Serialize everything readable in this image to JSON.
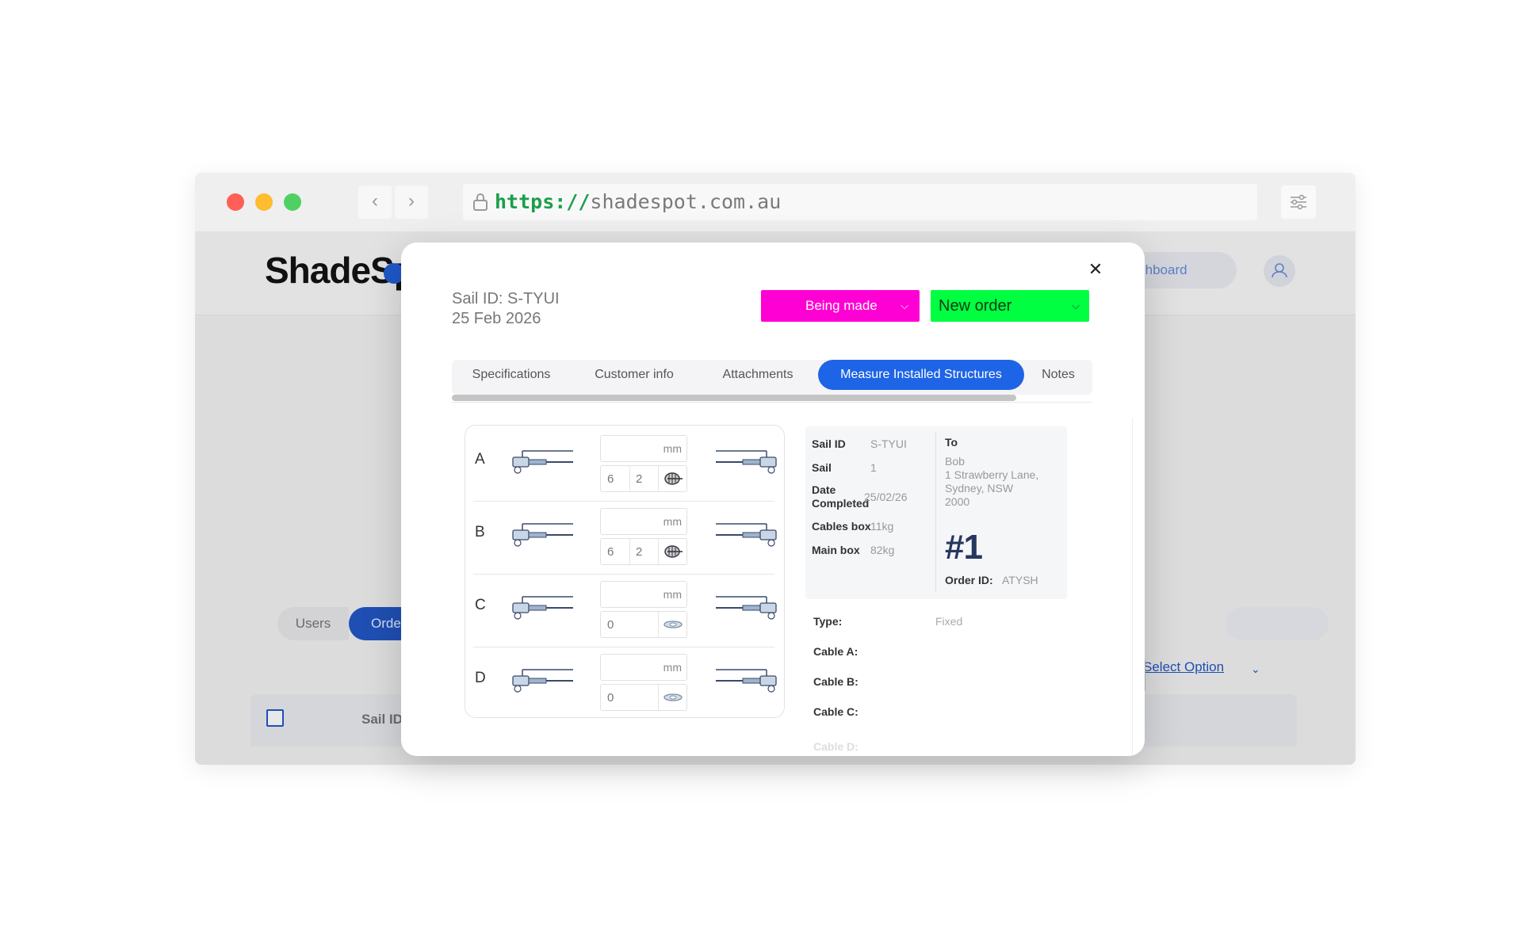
{
  "browser": {
    "url_scheme": "https://",
    "url_host": "shadespot.com.au"
  },
  "page": {
    "logo": "ShadeSp",
    "dashboard_link": "y dashboard",
    "tabs": {
      "users": "Users",
      "orders": "Orde"
    },
    "select_option": "Select Option",
    "table_header": {
      "sail_id": "Sail ID"
    }
  },
  "modal": {
    "sail_id": "Sail ID: S-TYUI",
    "date": "25 Feb 2026",
    "status": {
      "label": "Being made",
      "color": "#ff00d4"
    },
    "order_status": {
      "label": "New order",
      "color": "#00ff40"
    },
    "tabs": [
      {
        "label": "Specifications"
      },
      {
        "label": "Customer info"
      },
      {
        "label": "Attachments"
      },
      {
        "label": "Measure Installed Structures",
        "active": true
      },
      {
        "label": "Notes"
      }
    ],
    "cables": [
      {
        "letter": "A",
        "unit": "mm",
        "spec_a": "6",
        "spec_b": "2",
        "icon": "thimble-icon"
      },
      {
        "letter": "B",
        "unit": "mm",
        "spec_a": "6",
        "spec_b": "2",
        "icon": "thimble-icon"
      },
      {
        "letter": "C",
        "unit": "mm",
        "spec_a": "0",
        "icon": "shackle-icon"
      },
      {
        "letter": "D",
        "unit": "mm",
        "spec_a": "0",
        "icon": "shackle-icon"
      }
    ],
    "label": {
      "sail_id_label": "Sail ID",
      "sail_id_value": "S-TYUI",
      "sail_label": "Sail",
      "sail_value": "1",
      "date_label_1": "Date",
      "date_label_2": "Completed",
      "date_value": "25/02/26",
      "cables_box_label": "Cables box",
      "cables_box_value": "11kg",
      "main_box_label": "Main box",
      "main_box_value": "82kg",
      "to_label": "To",
      "to_name": "Bob",
      "to_street": "1 Strawberry Lane,",
      "to_city": "Sydney, NSW",
      "to_postcode": "2000",
      "big_number": "#1",
      "order_id_label": "Order ID:",
      "order_id_value": "ATYSH"
    },
    "specs": {
      "type_label": "Type:",
      "type_value": "Fixed",
      "cable_a_label": "Cable A:",
      "cable_b_label": "Cable B:",
      "cable_c_label": "Cable C:",
      "cable_d_label": "Cable D:"
    },
    "close_icon": "close-icon"
  }
}
